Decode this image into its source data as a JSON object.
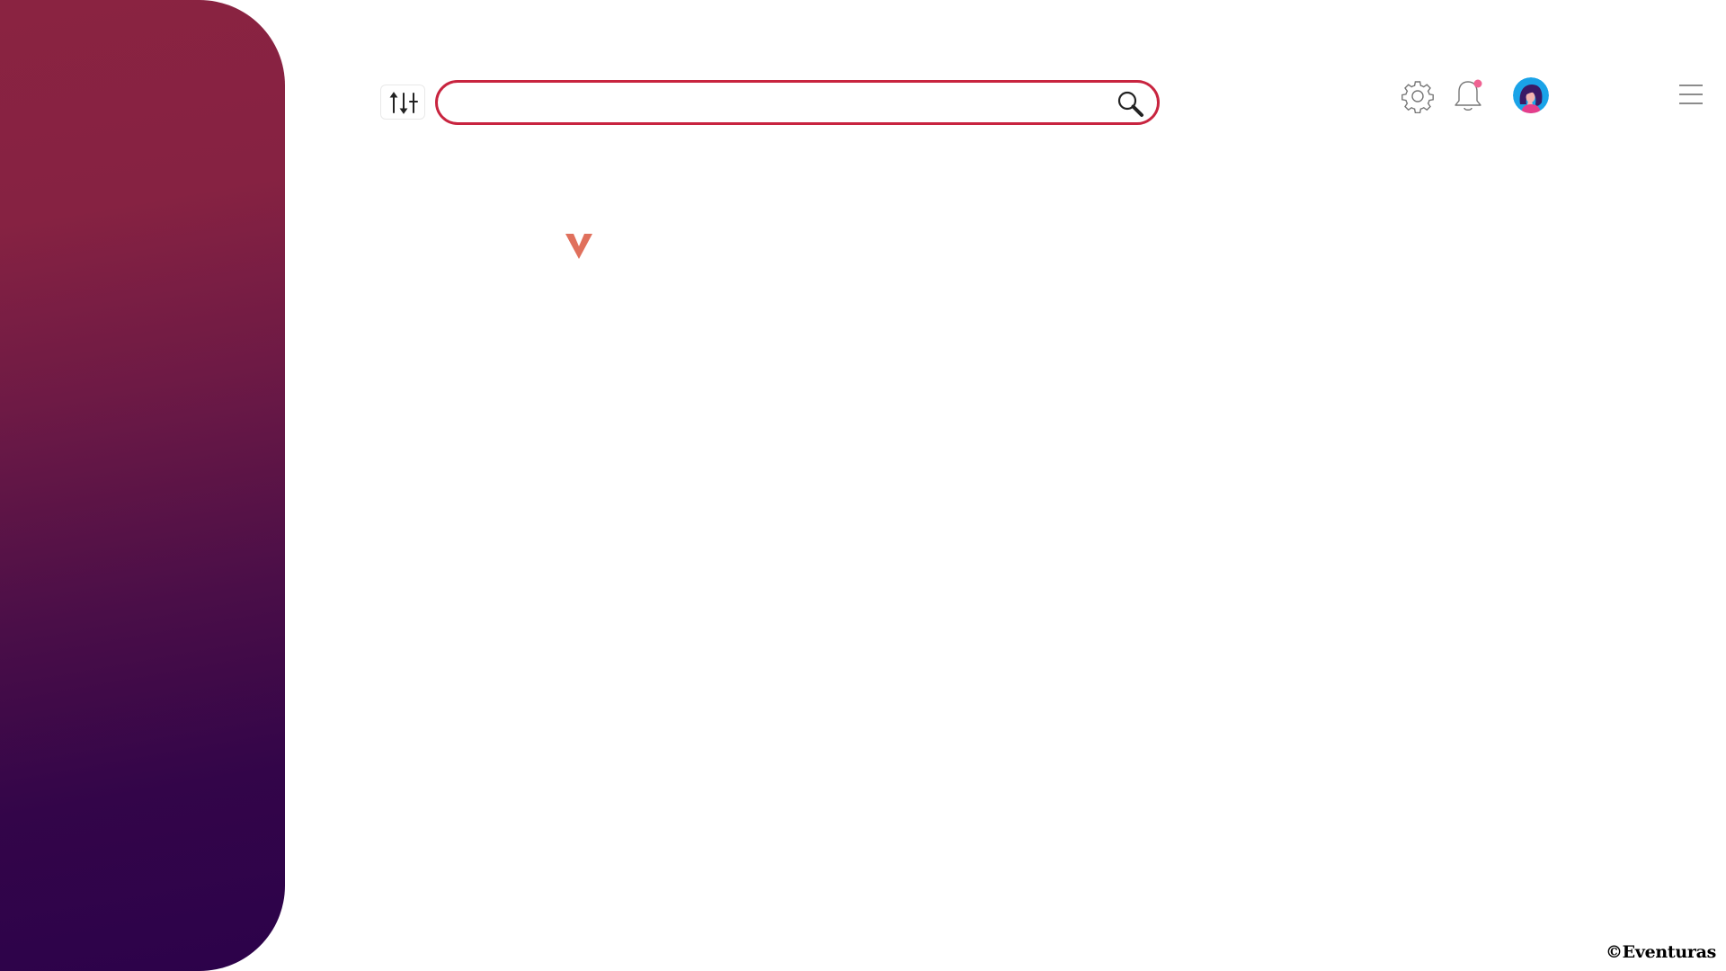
{
  "colors": {
    "sidebar_gradient_top": "#8a2341",
    "sidebar_gradient_bottom": "#2c024a",
    "search_border": "#c8243f",
    "chevron": "#e0705c",
    "notification_dot": "#f06292",
    "avatar_bg": "#1aa3e8"
  },
  "toolbar": {
    "filter_icon": "sliders-icon"
  },
  "search": {
    "value": "",
    "placeholder": "",
    "icon": "search-icon"
  },
  "header": {
    "settings_icon": "gear-icon",
    "notifications_icon": "bell-icon",
    "notifications_unread": true,
    "menu_icon": "hamburger-icon"
  },
  "footer": {
    "copyright": "©Eventuras"
  }
}
